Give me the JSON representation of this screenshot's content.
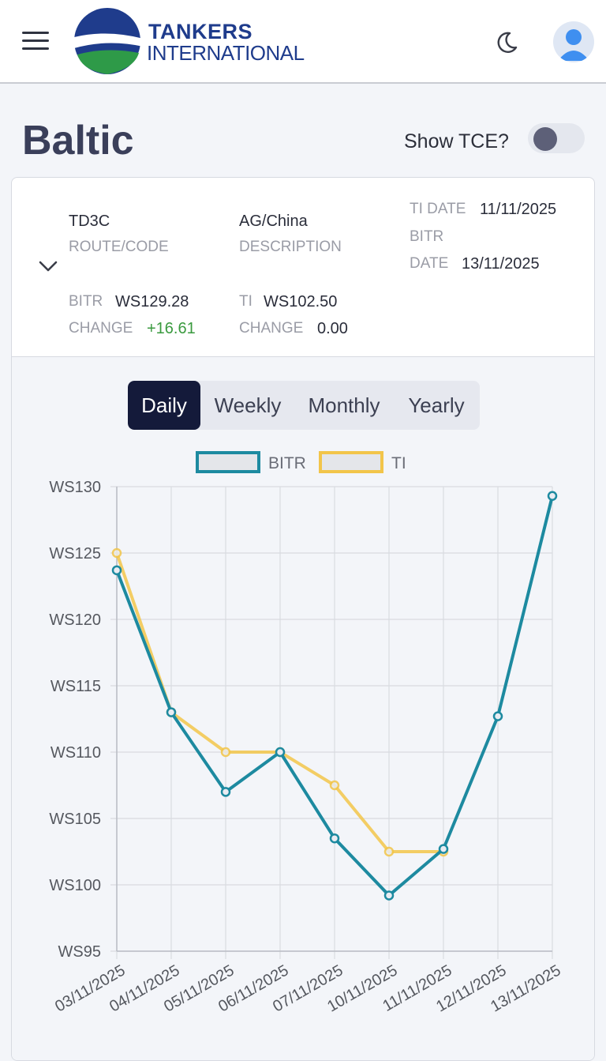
{
  "header": {
    "brand_line1": "TANKERS",
    "brand_line2": "INTERNATIONAL",
    "icons": [
      "menu-icon",
      "moon-icon",
      "user-icon"
    ]
  },
  "page": {
    "title": "Baltic",
    "tce_label": "Show TCE?",
    "tce_enabled": false
  },
  "route": {
    "code": "TD3C",
    "code_label": "ROUTE/CODE",
    "description": "AG/China",
    "description_label": "DESCRIPTION",
    "ti_date_label": "TI DATE",
    "ti_date": "11/11/2025",
    "bitr_label": "BITR",
    "date_label": "DATE",
    "bitr_date": "13/11/2025",
    "bitr_value_label": "BITR",
    "bitr_value": "WS129.28",
    "bitr_change_label": "CHANGE",
    "bitr_change": "+16.61",
    "ti_value_label": "TI",
    "ti_value": "WS102.50",
    "ti_change_label": "CHANGE",
    "ti_change": "0.00"
  },
  "tabs": [
    {
      "label": "Daily",
      "active": true
    },
    {
      "label": "Weekly",
      "active": false
    },
    {
      "label": "Monthly",
      "active": false
    },
    {
      "label": "Yearly",
      "active": false
    }
  ],
  "colors": {
    "bitr": "#1d8aa0",
    "ti": "#f2c54a",
    "positive": "#3a9a3f",
    "grid": "#d9dbe0",
    "tab_active": "#141a3a"
  },
  "chart_data": {
    "type": "line",
    "categories": [
      "03/11/2025",
      "04/11/2025",
      "05/11/2025",
      "06/11/2025",
      "07/11/2025",
      "10/11/2025",
      "11/11/2025",
      "12/11/2025",
      "13/11/2025"
    ],
    "series": [
      {
        "name": "BITR",
        "values": [
          123.7,
          113.0,
          107.0,
          110.0,
          103.5,
          99.2,
          102.7,
          112.7,
          129.3
        ]
      },
      {
        "name": "TI",
        "values": [
          125.0,
          113.0,
          110.0,
          110.0,
          107.5,
          102.5,
          102.5,
          null,
          null
        ]
      }
    ],
    "y_tick_labels": [
      "WS130",
      "WS125",
      "WS120",
      "WS115",
      "WS110",
      "WS105",
      "WS100",
      "WS95"
    ],
    "ylim": [
      95,
      130
    ],
    "grid": true,
    "legend": "top"
  }
}
